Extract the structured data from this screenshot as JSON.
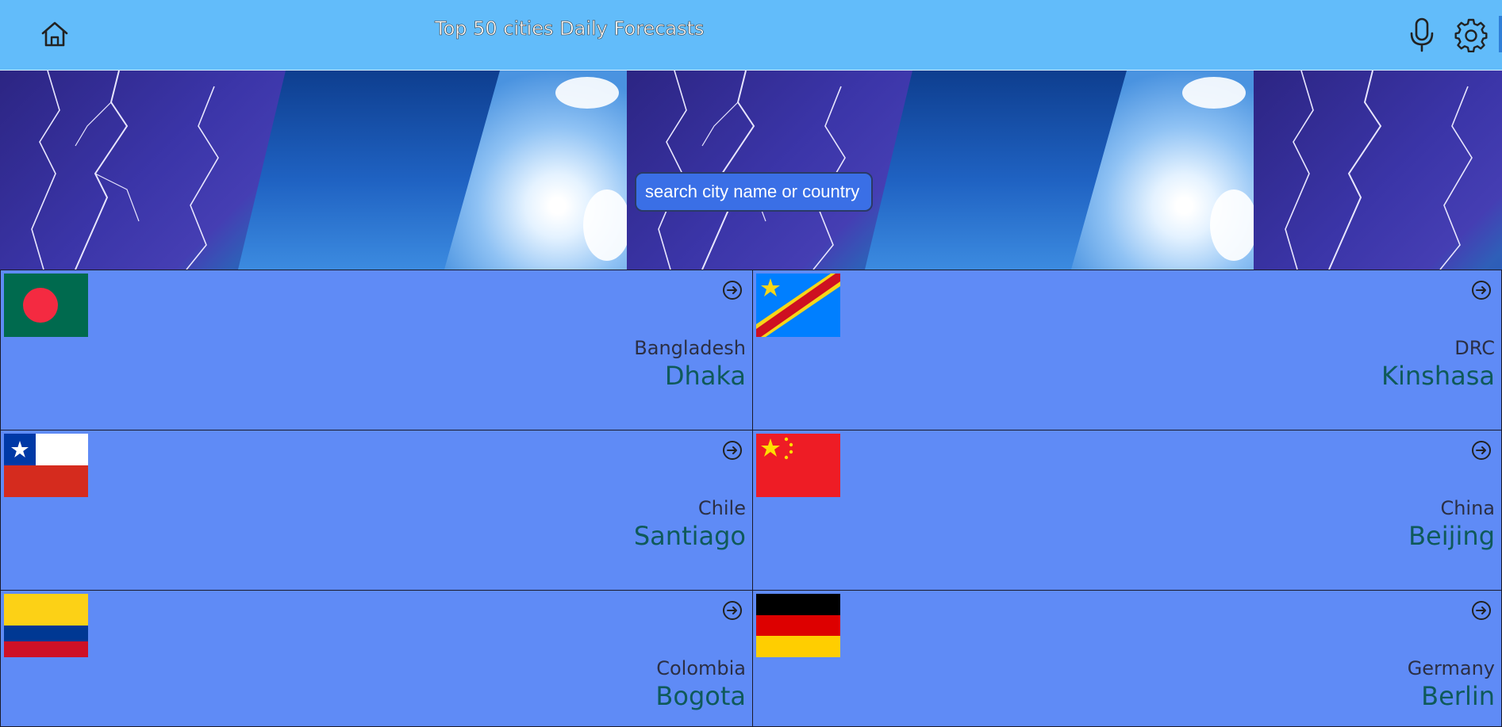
{
  "header": {
    "title": "Top 50 cities Daily Forecasts",
    "home_icon": "home-icon",
    "mic_icon": "microphone-icon",
    "settings_icon": "gear-icon"
  },
  "search": {
    "placeholder": "search city name or country"
  },
  "cities": [
    {
      "country": "Bangladesh",
      "city": "Dhaka",
      "flag": "bangladesh-flag"
    },
    {
      "country": "DRC",
      "city": "Kinshasa",
      "flag": "drc-flag"
    },
    {
      "country": "Chile",
      "city": "Santiago",
      "flag": "chile-flag"
    },
    {
      "country": "China",
      "city": "Beijing",
      "flag": "china-flag"
    },
    {
      "country": "Colombia",
      "city": "Bogota",
      "flag": "colombia-flag"
    },
    {
      "country": "Germany",
      "city": "Berlin",
      "flag": "germany-flag"
    }
  ],
  "colors": {
    "header_bg": "#62bcfa",
    "card_bg": "#5f8bf6",
    "search_bg": "#3a6fe6",
    "country_text": "#2b2f44",
    "city_text": "#0f5a5a"
  }
}
